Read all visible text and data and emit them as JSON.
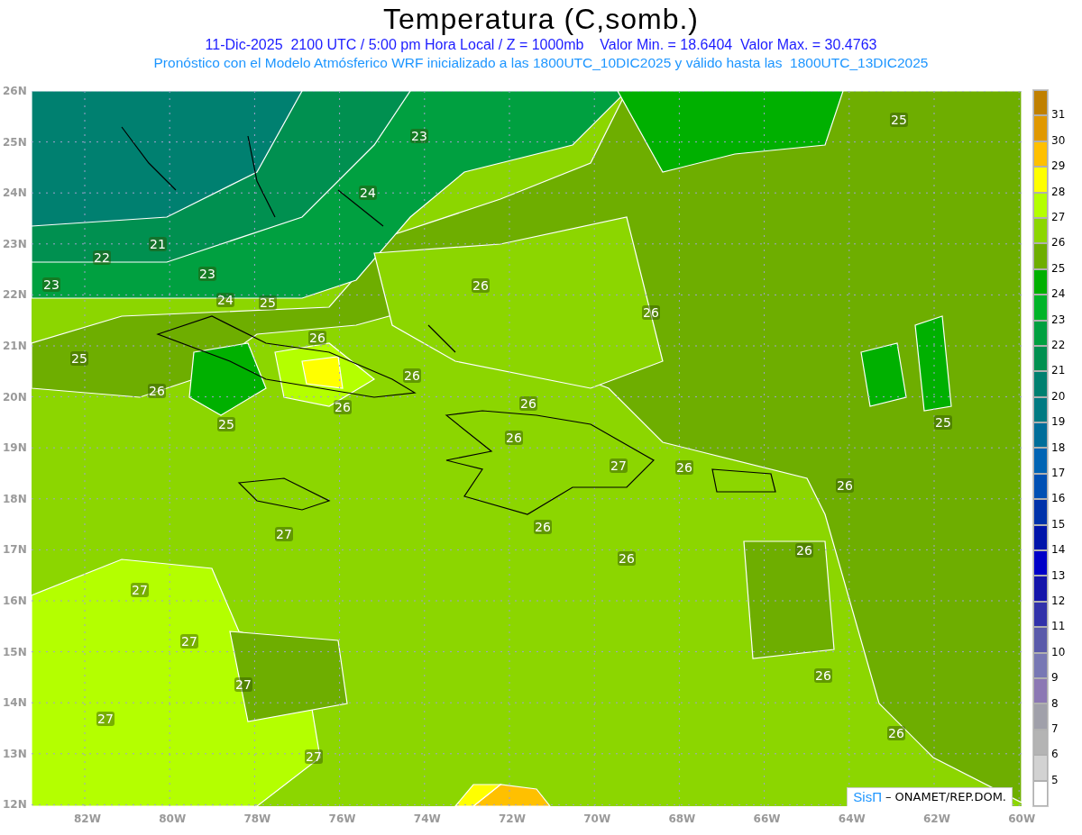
{
  "title": "Temperatura (C,somb.)",
  "subtitle": "11-Dic-2025  2100 UTC / 5:00 pm Hora Local / Z = 1000mb    Valor Min. = 18.6404  Valor Max. = 30.4763",
  "forecast_note": "Pronóstico con el Modelo Atmósferico WRF inicializado a las 1800UTC_10DIC2025 y válido hasta las  1800UTC_13DIC2025",
  "map": {
    "lat_labels": [
      "26N",
      "25N",
      "24N",
      "23N",
      "22N",
      "21N",
      "20N",
      "19N",
      "18N",
      "17N",
      "16N",
      "15N",
      "14N",
      "13N",
      "12N"
    ],
    "lon_labels": [
      "82W",
      "80W",
      "78W",
      "76W",
      "74W",
      "72W",
      "70W",
      "68W",
      "66W",
      "64W",
      "62W",
      "60W"
    ],
    "contour_labels": [
      "23",
      "25",
      "24",
      "21",
      "22",
      "23",
      "23",
      "24",
      "25",
      "26",
      "26",
      "26",
      "25",
      "26",
      "26",
      "26",
      "26",
      "25",
      "25",
      "26",
      "27",
      "26",
      "26",
      "26",
      "27",
      "26",
      "26",
      "27",
      "27",
      "26",
      "27",
      "27",
      "26",
      "27"
    ],
    "credit_brand": "SisΠ",
    "credit_text": "– ONAMET/REP.DOM."
  },
  "colorbar": {
    "bins": [
      {
        "color": "#c08000"
      },
      {
        "color": "#e09800"
      },
      {
        "color": "#ffc000"
      },
      {
        "color": "#ffff00"
      },
      {
        "color": "#b4ff00"
      },
      {
        "color": "#8cd600"
      },
      {
        "color": "#6eae00"
      },
      {
        "color": "#00b000"
      },
      {
        "color": "#00b428"
      },
      {
        "color": "#00a040"
      },
      {
        "color": "#009050"
      },
      {
        "color": "#008070"
      },
      {
        "color": "#007a82"
      },
      {
        "color": "#006e9a"
      },
      {
        "color": "#0064b4"
      },
      {
        "color": "#0050b4"
      },
      {
        "color": "#0032aa"
      },
      {
        "color": "#0014aa"
      },
      {
        "color": "#0000c8"
      },
      {
        "color": "#1414aa"
      },
      {
        "color": "#3232aa"
      },
      {
        "color": "#5a5aaa"
      },
      {
        "color": "#7878b4"
      },
      {
        "color": "#8c78b4"
      },
      {
        "color": "#a0a0aa"
      },
      {
        "color": "#b4b4b4"
      },
      {
        "color": "#d2d2d2"
      },
      {
        "color": "#ffffff"
      }
    ],
    "labels": [
      "31",
      "30",
      "29",
      "28",
      "27",
      "26",
      "25",
      "24",
      "23",
      "22",
      "21",
      "20",
      "19",
      "18",
      "17",
      "16",
      "15",
      "14",
      "13",
      "12",
      "11",
      "10",
      "9",
      "8",
      "7",
      "6",
      "5"
    ]
  }
}
